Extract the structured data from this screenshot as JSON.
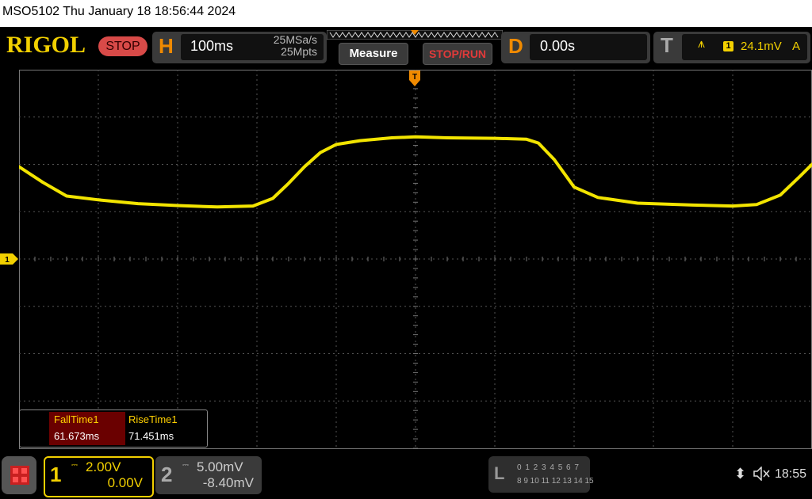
{
  "title_bar": {
    "text": "MSO5102  Thu January 18 18:56:44 2024"
  },
  "header": {
    "logo": "RIGOL",
    "run_state": "STOP",
    "horizontal": {
      "letter": "H",
      "timebase": "100ms",
      "sample_rate": "25MSa/s",
      "memory_depth": "25Mpts"
    },
    "measure_label": "Measure",
    "stop_run_label": "STOP/RUN",
    "delay": {
      "letter": "D",
      "value": "0.00s"
    },
    "trigger": {
      "letter": "T",
      "edge_icon": "rising-edge-icon",
      "edge_glyph": "⩚",
      "source": "1",
      "level": "24.1mV",
      "mode": "A"
    }
  },
  "display": {
    "trigger_marker": "T",
    "ch1_marker": "1",
    "trace_color": "#f2e400",
    "grid_divisions": {
      "horizontal": 10,
      "vertical": 8
    },
    "waveform": {
      "description_units": "time in divisions (0-10), amplitude in divisions relative to center",
      "points": [
        [
          0,
          1.95
        ],
        [
          0.3,
          1.62
        ],
        [
          0.6,
          1.33
        ],
        [
          1,
          1.25
        ],
        [
          1.5,
          1.17
        ],
        [
          2,
          1.13
        ],
        [
          2.5,
          1.1
        ],
        [
          2.95,
          1.12
        ],
        [
          3.2,
          1.28
        ],
        [
          3.4,
          1.6
        ],
        [
          3.6,
          1.95
        ],
        [
          3.8,
          2.25
        ],
        [
          4,
          2.42
        ],
        [
          4.3,
          2.5
        ],
        [
          4.7,
          2.56
        ],
        [
          5,
          2.58
        ],
        [
          5.4,
          2.56
        ],
        [
          6,
          2.55
        ],
        [
          6.4,
          2.53
        ],
        [
          6.55,
          2.45
        ],
        [
          6.75,
          2.1
        ],
        [
          7,
          1.52
        ],
        [
          7.3,
          1.3
        ],
        [
          7.8,
          1.18
        ],
        [
          8.5,
          1.14
        ],
        [
          9,
          1.12
        ],
        [
          9.3,
          1.15
        ],
        [
          9.6,
          1.35
        ],
        [
          9.85,
          1.75
        ],
        [
          10,
          2
        ]
      ]
    }
  },
  "measurements": [
    {
      "name": "FallTime1",
      "value": "61.673ms"
    },
    {
      "name": "RiseTime1",
      "value": "71.451ms"
    }
  ],
  "footer": {
    "ch1": {
      "number": "1",
      "coupling_icon": "dc-coupling-icon",
      "coupling_glyph": "⎓",
      "scale": "2.00V",
      "offset": "0.00V"
    },
    "ch2": {
      "number": "2",
      "coupling_icon": "dc-coupling-icon",
      "coupling_glyph": "⎓",
      "scale": "5.00mV",
      "offset": "-8.40mV"
    },
    "logic": {
      "letter": "L",
      "row1": "0 1 2 3  4 5 6 7",
      "row2": "8 9 10 11 12 13 14 15"
    },
    "usb_icon": "usb-icon",
    "usb_glyph": "⬍",
    "mute_icon": "speaker-muted-icon",
    "time": "18:55"
  }
}
